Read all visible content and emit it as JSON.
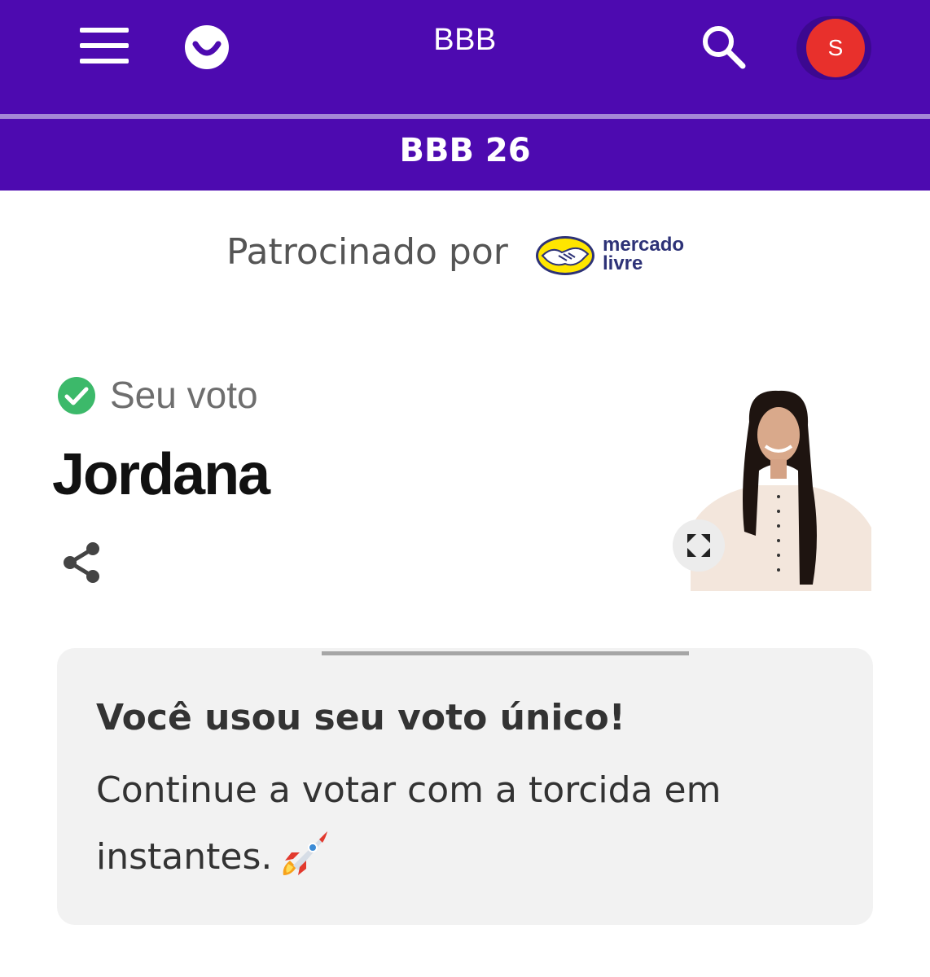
{
  "header": {
    "title": "BBB",
    "avatar_initial": "S",
    "menu_icon": "hamburger-menu-icon",
    "logo_icon": "smile-logo-icon",
    "search_icon": "search-icon",
    "brand_color": "#4d0ab0",
    "avatar_color": "#e8302c"
  },
  "subheader": {
    "title": "BBB 26"
  },
  "sponsor": {
    "label": "Patrocinado por",
    "logo_text_line1": "mercado",
    "logo_text_line2": "livre"
  },
  "vote": {
    "label": "Seu voto",
    "candidate": "Jordana",
    "check_color": "#3cb96a",
    "share_icon": "share-icon",
    "expand_icon": "expand-icon"
  },
  "message": {
    "title": "Você usou seu voto único!",
    "text": "Continue a votar com a torcida em instantes.",
    "emoji_icon": "rocket-icon"
  }
}
